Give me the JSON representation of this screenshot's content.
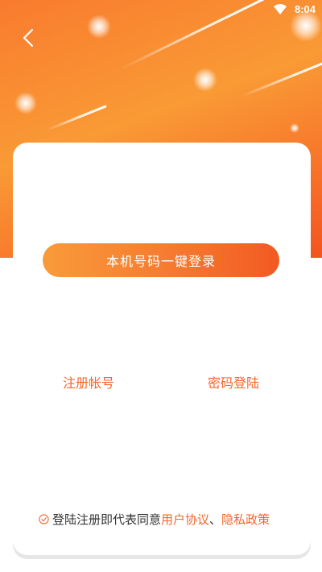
{
  "status_bar": {
    "time": "8:04",
    "wifi_icon": "wifi-icon"
  },
  "header": {
    "back_icon": "chevron-left-icon"
  },
  "login": {
    "one_tap_button": "本机号码一键登录",
    "register_link": "注册帐号",
    "password_login_link": "密码登陆"
  },
  "agreement": {
    "prefix": "登陆注册即代表同意",
    "user_agreement": "用户协议",
    "separator": "、",
    "privacy_policy": "隐私政策",
    "check_icon": "check-circle-icon"
  },
  "colors": {
    "accent": "#f4652a",
    "hero_start": "#f97b2e",
    "hero_end": "#f2541f",
    "button_start": "#f99b3a",
    "button_end": "#f25a22"
  }
}
